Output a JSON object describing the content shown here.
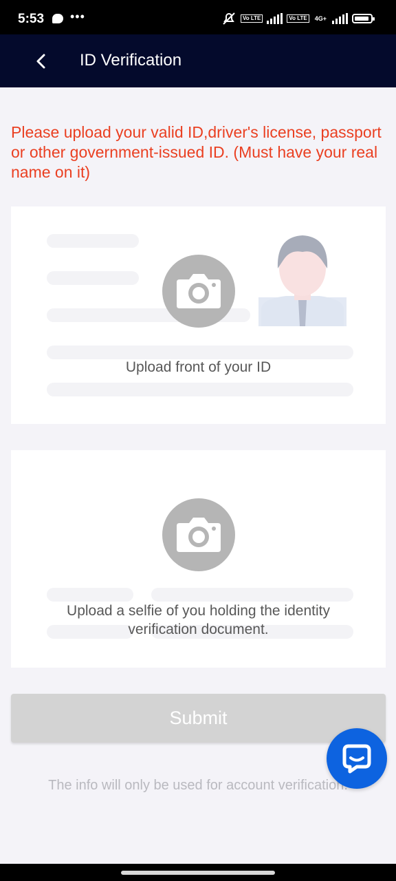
{
  "status_bar": {
    "time": "5:53",
    "icons": [
      "chat-bubble-icon",
      "more-dots-icon",
      "mute-icon",
      "volte-icon",
      "signal-icon",
      "4g-icon",
      "battery-icon"
    ],
    "more": "•••",
    "volte1": "Vo LTE",
    "volte2": "Vo LTE",
    "net": "4G+"
  },
  "header": {
    "title": "ID Verification",
    "back_icon": "chevron-left-icon",
    "background": "#040a2c"
  },
  "notice": {
    "text": "Please upload your valid ID,driver's license, passport or other government-issued ID. (Must have your real name on it)",
    "color": "#ea3f21"
  },
  "uploads": {
    "front": {
      "label": "Upload front of your ID",
      "icon": "camera-icon"
    },
    "selfie": {
      "label": "Upload a selfie of you holding the identity verification document.",
      "icon": "camera-icon"
    }
  },
  "submit": {
    "label": "Submit"
  },
  "footnote": "The info will only be used for account verification.",
  "chat_button": {
    "icon": "chat-icon",
    "color": "#0d63e0"
  }
}
